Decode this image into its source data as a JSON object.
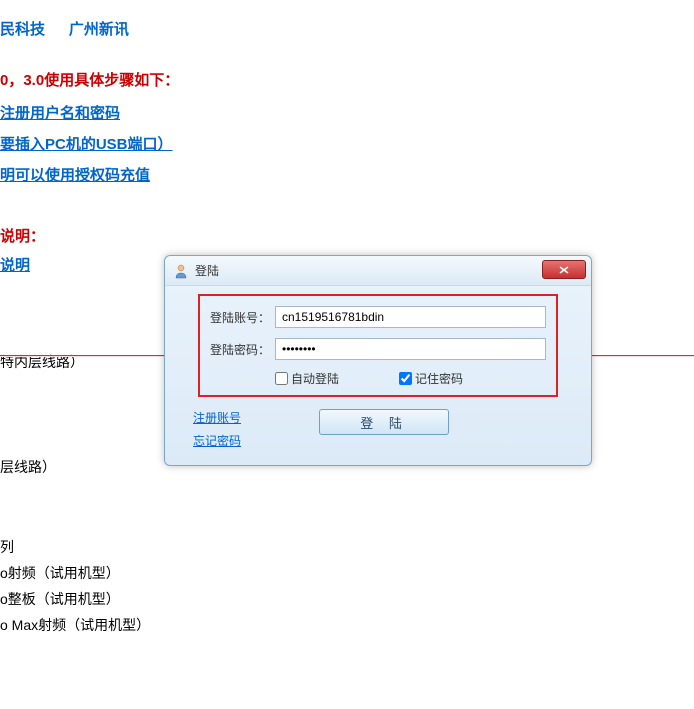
{
  "topLinks": {
    "link1": "民科技",
    "link2": "广州新讯"
  },
  "heading1": "0，3.0使用具体步骤如下：",
  "links": {
    "step1": "注册用户名和密码",
    "step2": "要插入PC机的USB端口）",
    "step3": "明可以使用授权码充值"
  },
  "labels": {
    "redExplain": "说明：",
    "blueExplain": "说明"
  },
  "bodyText": {
    "t1": "特内层线路）",
    "t2": "层线路）",
    "t3": "列",
    "t4": "o射频（试用机型）",
    "t5": "o整板（试用机型）",
    "t6": "o Max射频（试用机型）"
  },
  "dialog": {
    "title": "登陆",
    "closeSymbol": "X",
    "accountLabel": "登陆账号：",
    "accountValue": "cn1519516781bdin",
    "passwordLabel": "登陆密码：",
    "passwordValue": "••••••••",
    "autoLogin": "自动登陆",
    "rememberPwd": "记住密码",
    "registerLink": "注册账号",
    "forgotLink": "忘记密码",
    "loginBtn": "登 陆"
  }
}
